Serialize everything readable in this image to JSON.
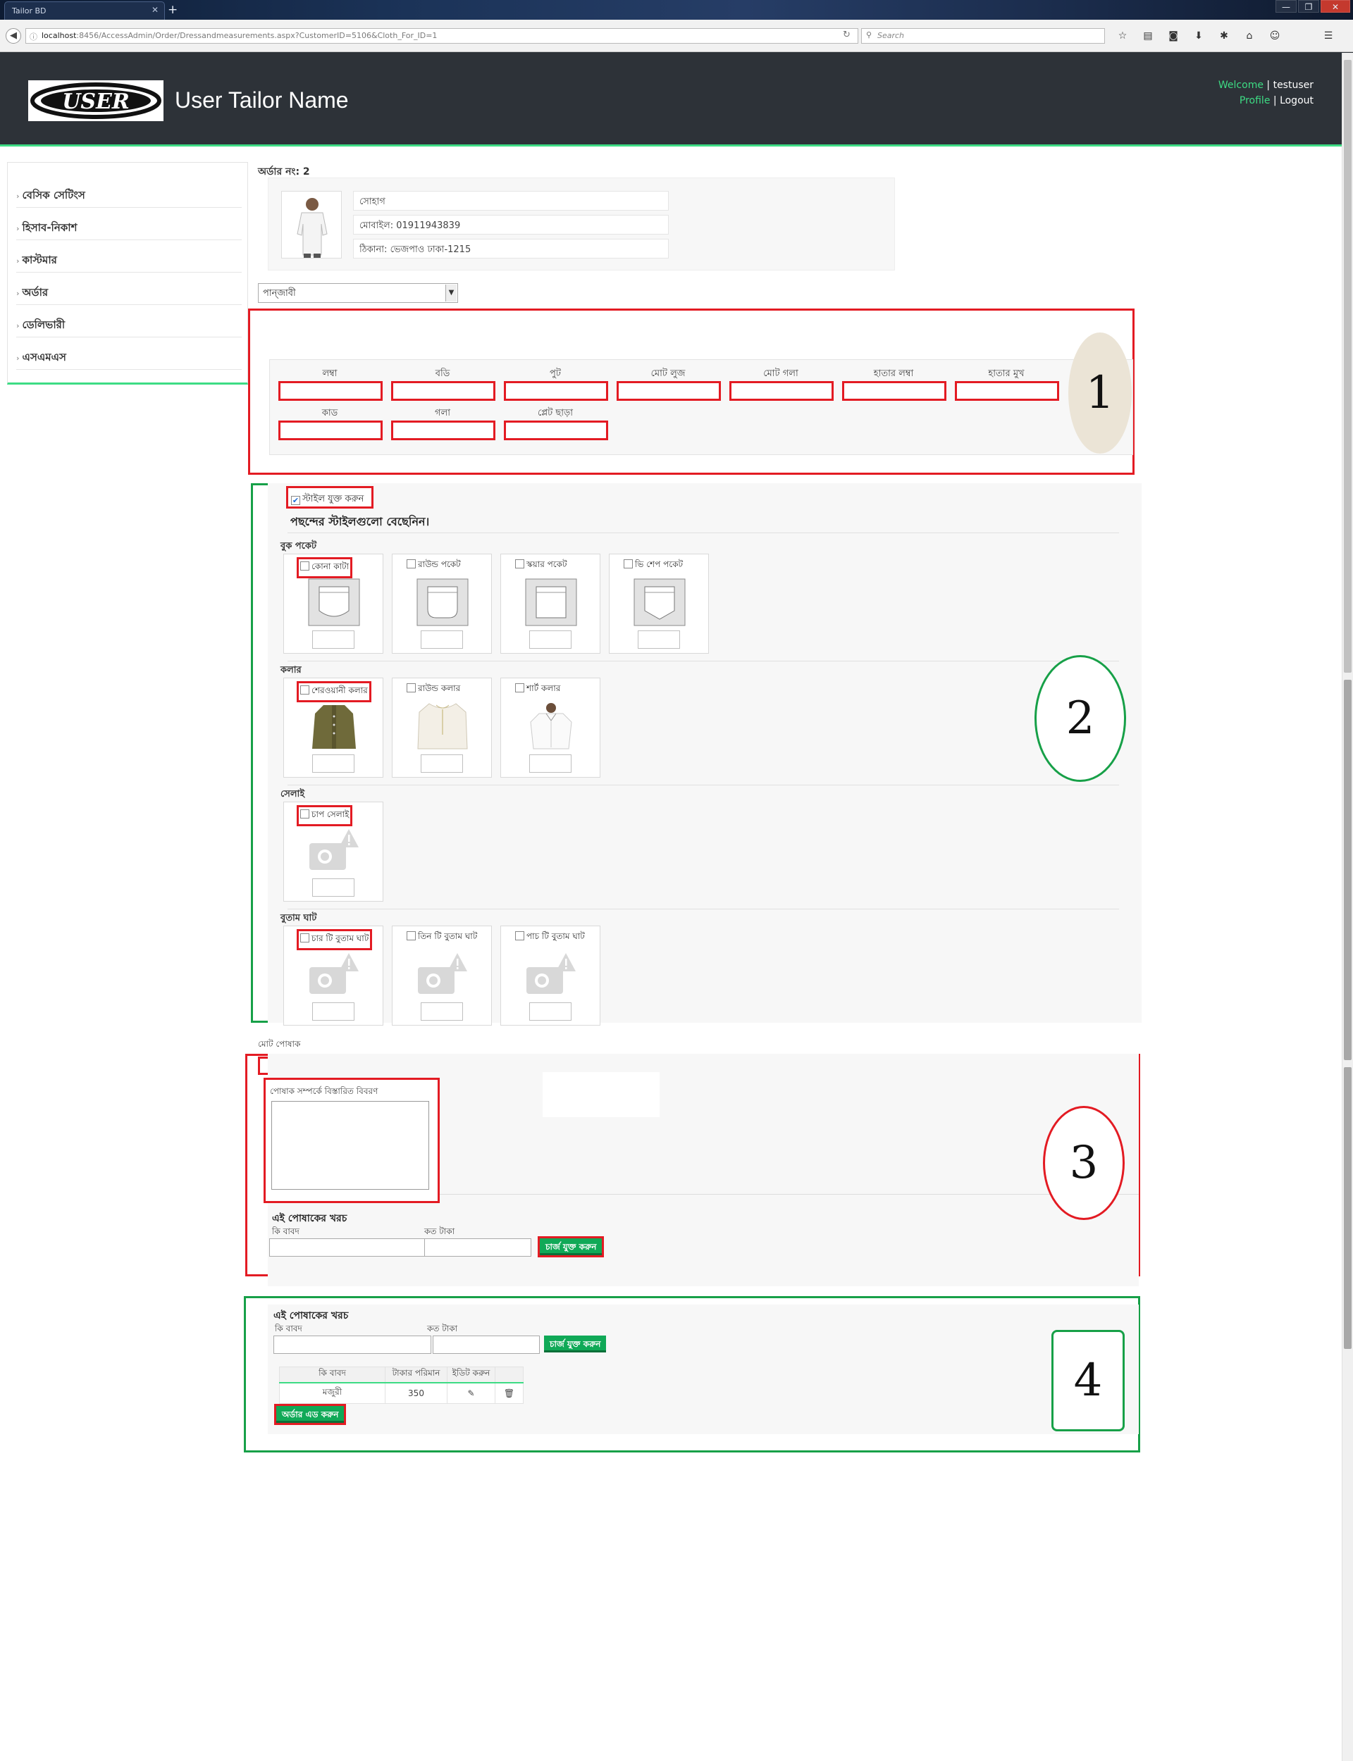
{
  "browser": {
    "tab_title": "Tailor BD",
    "new_tab": "+",
    "url_host": "localhost",
    "url_path": ":8456/AccessAdmin/Order/Dressandmeasurements.aspx?CustomerID=5106&Cloth_For_ID=1",
    "search_placeholder": "Search",
    "window_buttons": [
      "—",
      "❐",
      "✕"
    ]
  },
  "header": {
    "logo_text": "USER",
    "brand_name": "User Tailor Name",
    "welcome_label": "Welcome",
    "separator": "|",
    "username": "testuser",
    "profile_link": "Profile",
    "logout_link": "Logout"
  },
  "sidebar": {
    "items": [
      {
        "label": "বেসিক সেটিংস"
      },
      {
        "label": "হিসাব-নিকাশ"
      },
      {
        "label": "কাস্টমার"
      },
      {
        "label": "অর্ডার"
      },
      {
        "label": "ডেলিভারী"
      },
      {
        "label": "এসএমএস"
      }
    ]
  },
  "order": {
    "order_no_label": "অর্ডার নং: 2"
  },
  "customer": {
    "name": "সোহাগ",
    "mobile": "মোবাইল: 01911943839",
    "address": "ঠিকানা: ভেজপাও ঢাকা-1215"
  },
  "cloth_select": {
    "value": "পান্জাবী"
  },
  "measurements": {
    "row1": [
      "লম্বা",
      "বডি",
      "পুট",
      "মোট লুজ",
      "মোট গলা",
      "হাতার লম্বা",
      "হাতার মুখ"
    ],
    "row2": [
      "কাড",
      "গলা",
      "প্লেট ছাড়া"
    ]
  },
  "styles": {
    "add_style_label": "স্টাইল যুক্ত করুন",
    "heading": "পছন্দের স্টাইলগুলো বেছেনিন।",
    "groups": [
      {
        "title": "বুক পকেট",
        "options": [
          "কোনা কাটা",
          "রাউন্ড পকেট",
          "স্কয়ার পকেট",
          "ভি শেপ পকেট"
        ]
      },
      {
        "title": "কলার",
        "options": [
          "শেরওয়ানী কলার",
          "রাউন্ড কলার",
          "শার্ট কলার"
        ]
      },
      {
        "title": "সেলাই",
        "options": [
          "চাপ সেলাই"
        ]
      },
      {
        "title": "বুতাম ঘাট",
        "options": [
          "চার টি বুতাম ঘাট",
          "তিন টি বুতাম ঘাট",
          "পাচ টি বুতাম ঘাট"
        ]
      }
    ]
  },
  "section3": {
    "total_dress_label": "মোট পোষাক",
    "description_label": "পোষাক সম্পর্কে বিস্তারিত বিবরণ",
    "cost_title": "এই পোষাকের খরচ",
    "purpose_label": "কি বাবদ",
    "amount_label": "কত টাকা",
    "add_charge_button": "চার্জ যুক্ত করুন"
  },
  "section4": {
    "cost_title": "এই পোষাকের খরচ",
    "purpose_label": "কি বাবদ",
    "amount_label": "কত টাকা",
    "add_charge_button": "চার্জ যুক্ত করুন",
    "table": {
      "headers": [
        "কি বাবদ",
        "টাকার পরিমান",
        "ইডিট করুন",
        ""
      ],
      "rows": [
        {
          "purpose": "মজুরী",
          "amount": "350"
        }
      ]
    },
    "add_order_button": "অর্ডার এড করুন"
  },
  "annotations": {
    "numbers": [
      "1",
      "2",
      "3",
      "4"
    ]
  },
  "colors": {
    "accent_green": "#3ddc84",
    "button_green": "#10a957",
    "annotation_red": "#e31b23",
    "annotation_green": "#17a048",
    "header_dark": "#2d3238"
  }
}
